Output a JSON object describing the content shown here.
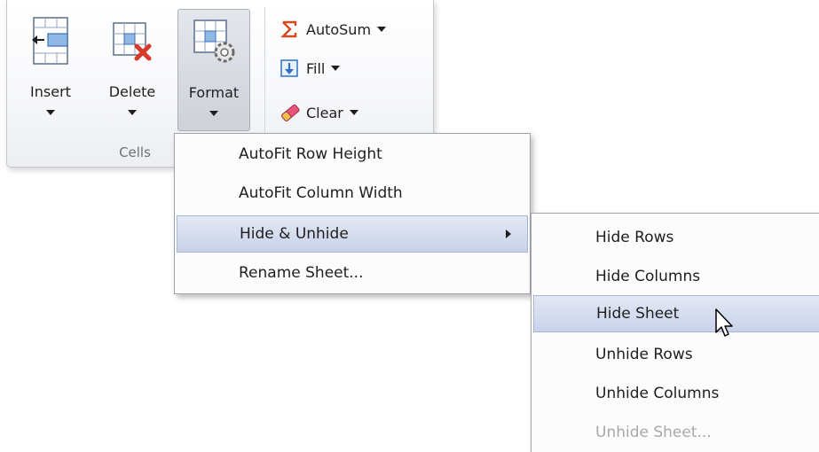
{
  "ribbon": {
    "group_label": "Cells",
    "buttons": {
      "insert": "Insert",
      "delete": "Delete",
      "format": "Format"
    },
    "small_buttons": {
      "autosum": "AutoSum",
      "fill": "Fill",
      "clear": "Clear"
    }
  },
  "format_menu": {
    "items": [
      {
        "label": "AutoFit Row Height"
      },
      {
        "label": "AutoFit Column Width"
      },
      {
        "label": "Hide & Unhide",
        "highlighted": true,
        "has_submenu": true
      },
      {
        "label": "Rename Sheet..."
      }
    ]
  },
  "hide_unhide_menu": {
    "items": [
      {
        "label": "Hide Rows"
      },
      {
        "label": "Hide Columns"
      },
      {
        "label": "Hide Sheet",
        "highlighted": true
      },
      {
        "label": "Unhide Rows"
      },
      {
        "label": "Unhide Columns"
      },
      {
        "label": "Unhide Sheet...",
        "disabled": true
      }
    ]
  },
  "colors": {
    "highlight": "#c8d2ea",
    "disabled_text": "#a8a8a8",
    "autosum_icon": "#d24a1e",
    "fill_icon": "#2f6fc6"
  },
  "icons": {
    "insert": "insert-cells-icon",
    "delete": "delete-cells-icon",
    "format": "format-cells-gear-icon",
    "autosum": "sigma-icon",
    "fill": "fill-down-arrow-icon",
    "clear": "eraser-icon"
  }
}
